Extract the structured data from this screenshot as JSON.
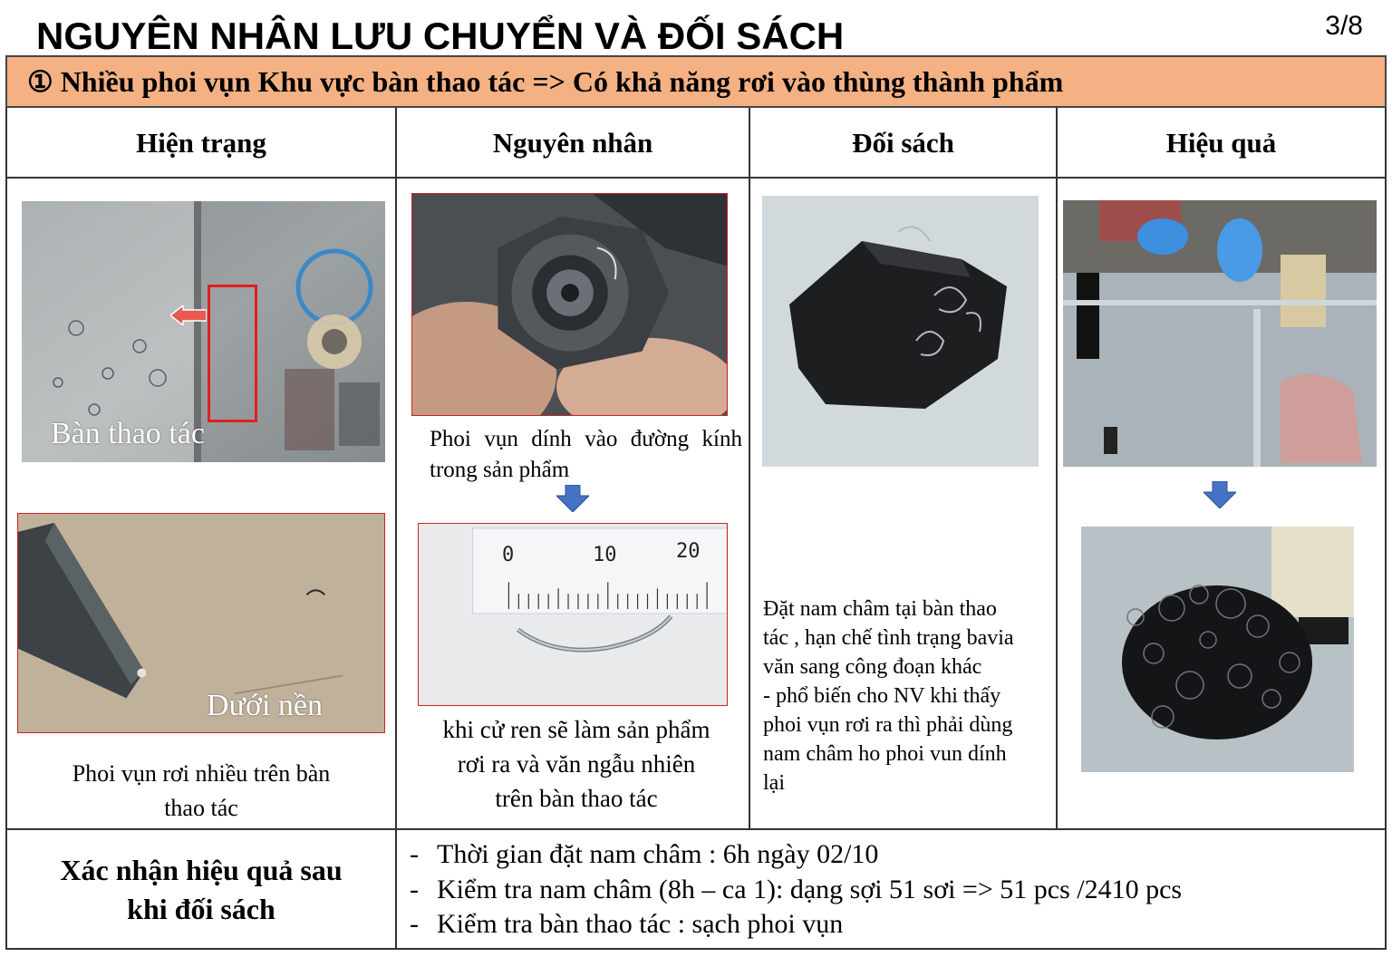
{
  "header": {
    "title": "NGUYÊN NHÂN LƯU CHUYỂN VÀ ĐỐI SÁCH",
    "page": "3/8"
  },
  "banner": {
    "text": "① Nhiều phoi vụn Khu vực bàn thao tác => Có khả năng rơi vào thùng thành phẩm",
    "color": "#f4b183"
  },
  "columns": [
    {
      "heading": "Hiện trạng"
    },
    {
      "heading": "Nguyên nhân"
    },
    {
      "heading": "Đối sách"
    },
    {
      "heading": "Hiệu quả"
    }
  ],
  "hien_trang": {
    "photo1_label": "Bàn thao tác",
    "photo2_label": "Dưới nền",
    "caption_line1": "Phoi vụn rơi nhiều trên bàn",
    "caption_line2": "thao tác"
  },
  "nguyen_nhan": {
    "photo1_caption_line1": "Phoi vụn dính vào đường kính",
    "photo1_caption_line2": "trong sản phẩm",
    "ruler_tick_0": "0",
    "ruler_tick_10": "10",
    "ruler_tick_20": "20",
    "caption_line1": "khi cử ren sẽ làm sản phẩm",
    "caption_line2": "rơi ra và văn ngẫu nhiên",
    "caption_line3": "trên bàn thao tác"
  },
  "doi_sach": {
    "lines": [
      "Đặt nam châm tại bàn thao",
      "tác , hạn chế tình trạng bavia",
      "văn sang công đoạn khác",
      "- phổ biến cho NV khi  thấy",
      "phoi vụn rơi ra thì phải dùng",
      "nam châm ho phoi vun dính",
      "lại"
    ]
  },
  "footer": {
    "heading_line1": "Xác nhận hiệu quả sau",
    "heading_line2": "khi đối sách",
    "items": [
      "Thời gian đặt nam châm : 6h ngày 02/10",
      "Kiểm tra nam châm (8h – ca 1): dạng sợi 51 sơi => 51 pcs /2410 pcs",
      "Kiểm tra bàn thao tác : sạch phoi vụn"
    ]
  },
  "colors": {
    "arrow_blue": "#4472c4",
    "highlight_red": "#e02020",
    "photo_border_red": "#cc2222"
  }
}
